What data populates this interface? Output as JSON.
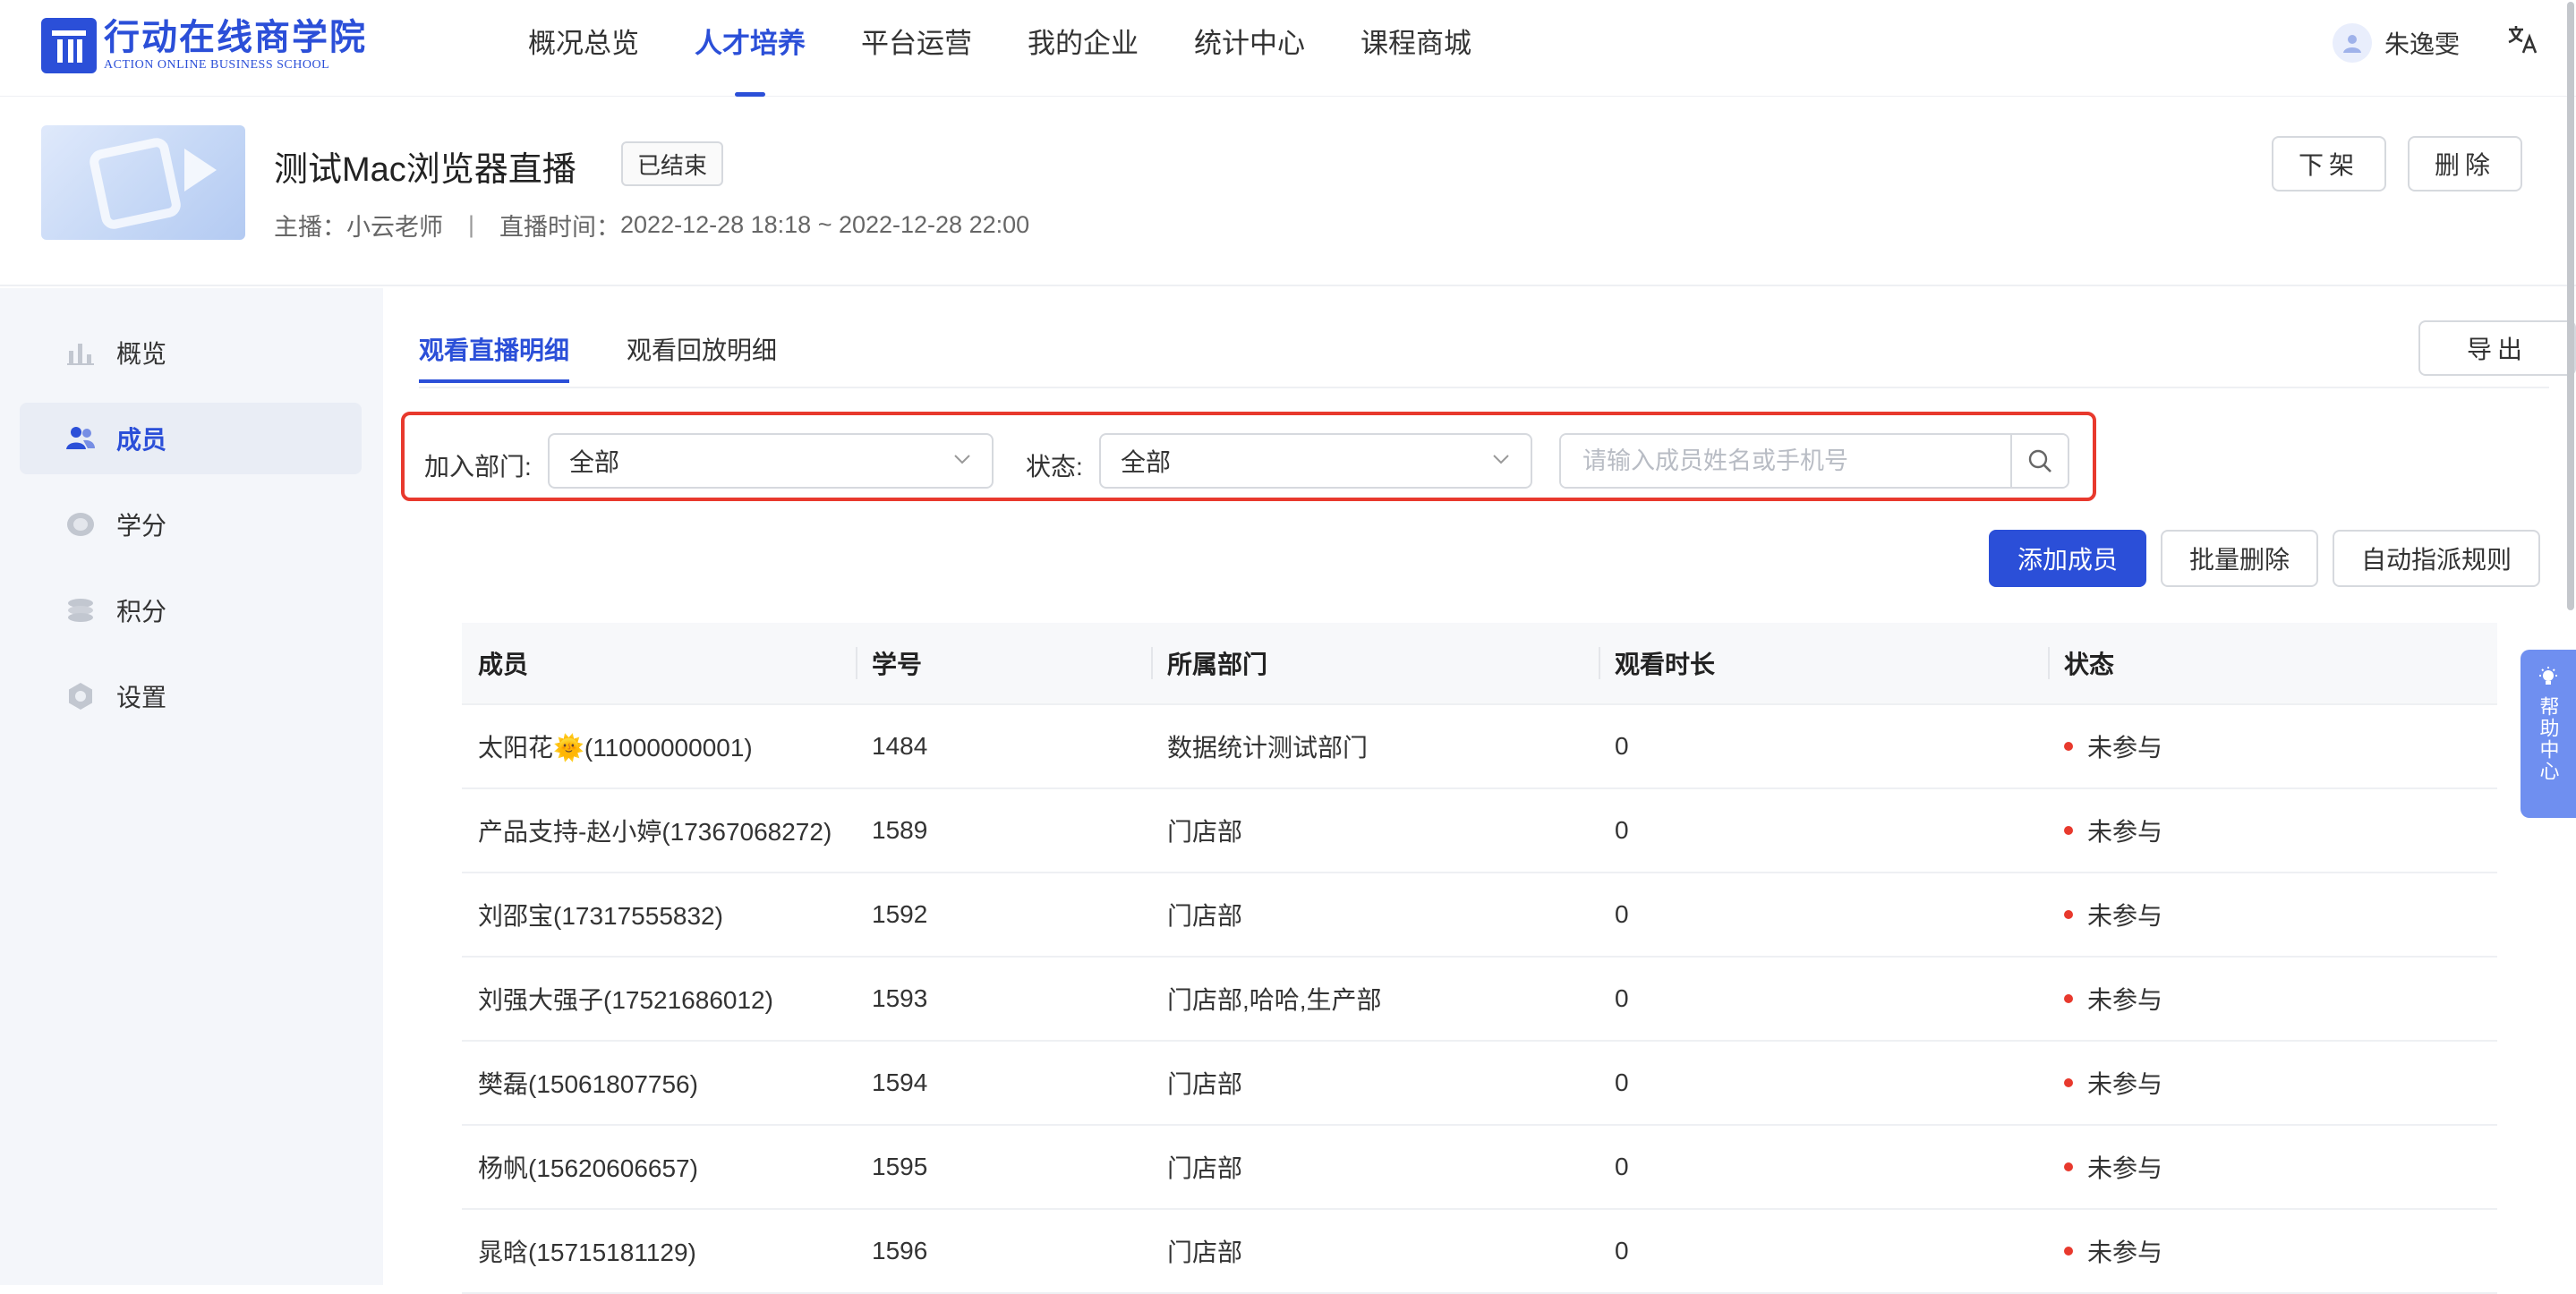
{
  "brand": {
    "name_cn": "行动在线商学院",
    "name_en": "ACTION ONLINE BUSINESS SCHOOL",
    "color": "#2b4fd8"
  },
  "nav": {
    "items": [
      {
        "label": "概况总览",
        "active": false
      },
      {
        "label": "人才培养",
        "active": true
      },
      {
        "label": "平台运营",
        "active": false
      },
      {
        "label": "我的企业",
        "active": false
      },
      {
        "label": "统计中心",
        "active": false
      },
      {
        "label": "课程商城",
        "active": false
      }
    ],
    "user_name": "朱逸雯",
    "lang_icon": "translate-icon"
  },
  "live": {
    "title": "测试Mac浏览器直播",
    "status": "已结束",
    "host_label": "主播：",
    "host": "小云老师",
    "separator": "|",
    "time_label": "直播时间：",
    "time_range": "2022-12-28 18:18 ~ 2022-12-28 22:00",
    "offshelf_label": "下架",
    "delete_label": "删除"
  },
  "sidebar": {
    "items": [
      {
        "label": "概览",
        "icon": "bar-chart-icon",
        "active": false
      },
      {
        "label": "成员",
        "icon": "users-icon",
        "active": true
      },
      {
        "label": "学分",
        "icon": "credit-icon",
        "active": false
      },
      {
        "label": "积分",
        "icon": "coins-icon",
        "active": false
      },
      {
        "label": "设置",
        "icon": "gear-icon",
        "active": false
      }
    ]
  },
  "tabs": {
    "live_detail": "观看直播明细",
    "replay_detail": "观看回放明细",
    "export_label": "导出"
  },
  "filters": {
    "dept_label": "加入部门:",
    "dept_value": "全部",
    "status_label": "状态:",
    "status_value": "全部",
    "search_placeholder": "请输入成员姓名或手机号"
  },
  "actions": {
    "add_member": "添加成员",
    "batch_delete": "批量删除",
    "auto_assign": "自动指派规则"
  },
  "table": {
    "headers": [
      "成员",
      "学号",
      "所属部门",
      "观看时长",
      "状态"
    ],
    "rows": [
      {
        "member": "太阳花🌞(11000000001)",
        "id": "1484",
        "dept": "数据统计测试部门",
        "duration": "0",
        "status": "未参与"
      },
      {
        "member": "产品支持-赵小婷(17367068272)",
        "id": "1589",
        "dept": "门店部",
        "duration": "0",
        "status": "未参与"
      },
      {
        "member": "刘邵宝(17317555832)",
        "id": "1592",
        "dept": "门店部",
        "duration": "0",
        "status": "未参与"
      },
      {
        "member": "刘强大强子(17521686012)",
        "id": "1593",
        "dept": "门店部,哈哈,生产部",
        "duration": "0",
        "status": "未参与"
      },
      {
        "member": "樊磊(15061807756)",
        "id": "1594",
        "dept": "门店部",
        "duration": "0",
        "status": "未参与"
      },
      {
        "member": "杨帆(15620606657)",
        "id": "1595",
        "dept": "门店部",
        "duration": "0",
        "status": "未参与"
      },
      {
        "member": "晁晗(15715181129)",
        "id": "1596",
        "dept": "门店部",
        "duration": "0",
        "status": "未参与"
      }
    ]
  },
  "help": {
    "label": "帮助中心"
  },
  "colors": {
    "primary": "#2b4fd8",
    "highlight_border": "#e8392d",
    "status_dot": "#e8392d"
  }
}
